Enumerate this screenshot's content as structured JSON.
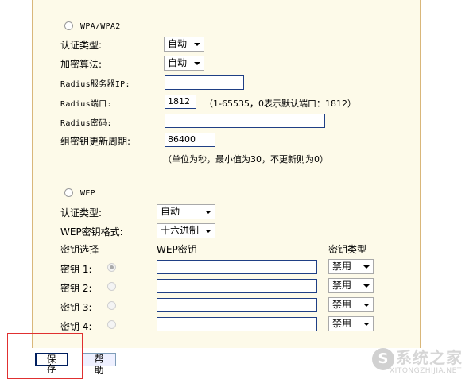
{
  "wpa": {
    "radio_label": "WPA/WPA2",
    "auth_type_label": "认证类型:",
    "auth_type_value": "自动",
    "encryption_label": "加密算法:",
    "encryption_value": "自动",
    "radius_ip_label": "Radius服务器IP:",
    "radius_ip_value": "",
    "radius_port_label": "Radius端口:",
    "radius_port_value": "1812",
    "radius_port_hint": "（1-65535，0表示默认端口：1812）",
    "radius_password_label": "Radius密码:",
    "radius_password_value": "",
    "group_key_period_label": "组密钥更新周期:",
    "group_key_period_value": "86400",
    "group_key_period_hint": "（单位为秒，最小值为30，不更新则为0）"
  },
  "wep": {
    "radio_label": "WEP",
    "auth_type_label": "认证类型:",
    "auth_type_value": "自动",
    "key_format_label": "WEP密钥格式:",
    "key_format_value": "十六进制",
    "col_key_select": "密钥选择",
    "col_wep_key": "WEP密钥",
    "col_key_type": "密钥类型",
    "keys": [
      {
        "label": "密钥 1:",
        "value": "",
        "type": "禁用"
      },
      {
        "label": "密钥 2:",
        "value": "",
        "type": "禁用"
      },
      {
        "label": "密钥 3:",
        "value": "",
        "type": "禁用"
      },
      {
        "label": "密钥 4:",
        "value": "",
        "type": "禁用"
      }
    ]
  },
  "buttons": {
    "save": "保存",
    "help": "帮助"
  },
  "watermark": {
    "logo": "S",
    "name": "系统之家",
    "url": "XITONGZHIJIA.NET"
  },
  "colors": {
    "panel_bg": "#fdfae9",
    "panel_border": "#d9b77a",
    "highlight": "#e03030",
    "input_border": "#1f3f85"
  }
}
